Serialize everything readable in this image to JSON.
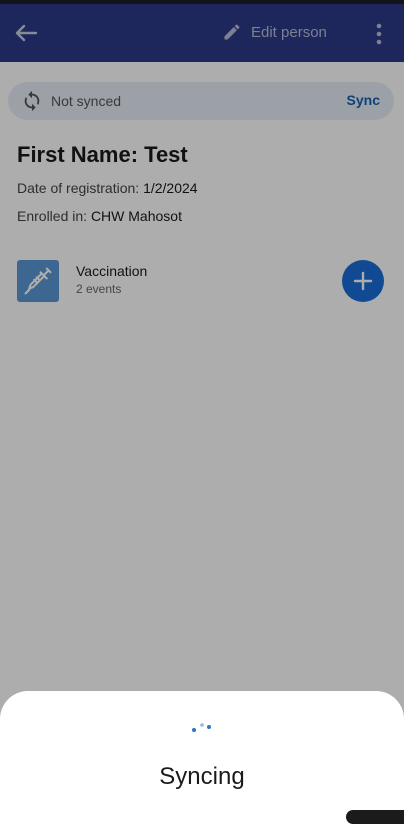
{
  "appbar": {
    "back_icon": "arrow-back-icon",
    "edit_icon": "pencil-icon",
    "edit_label": "Edit person",
    "more_icon": "more-vertical-icon",
    "color": "#2c3a86"
  },
  "sync_bar": {
    "icon": "sync-icon",
    "status": "Not synced",
    "action_label": "Sync"
  },
  "person": {
    "name": "First Name: Test",
    "registration_label": "Date of registration:",
    "registration_value": "1/2/2024",
    "enrolled_label": "Enrolled in:",
    "enrolled_value": "CHW Mahosot"
  },
  "program": {
    "icon": "syringe-icon",
    "title": "Vaccination",
    "subtitle": "2 events",
    "add_icon": "plus-icon"
  },
  "sheet": {
    "spinner_icon": "loading-spinner-icon",
    "title": "Syncing"
  }
}
